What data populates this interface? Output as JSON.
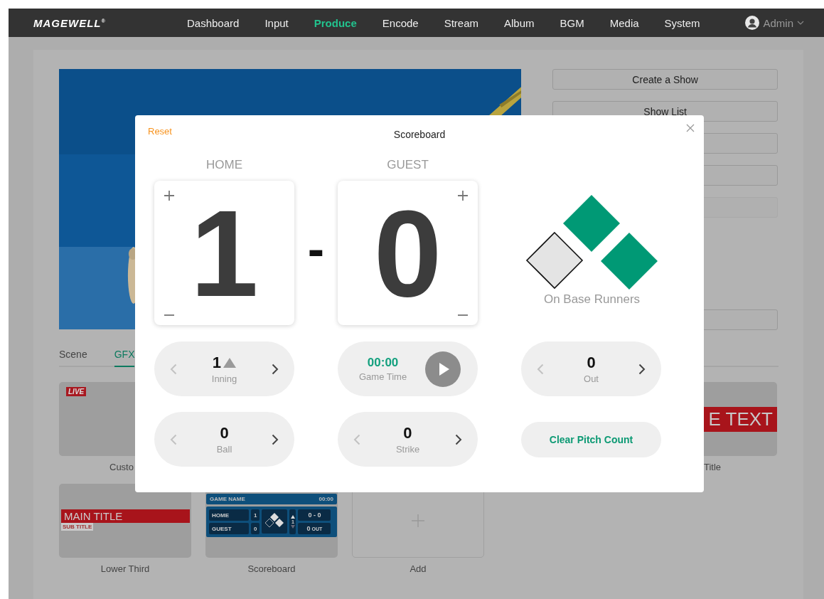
{
  "nav": {
    "logo": "MAGEWELL$^{®}$",
    "items": [
      {
        "label": "Dashboard",
        "selected": false
      },
      {
        "label": "Input",
        "selected": false
      },
      {
        "label": "Produce",
        "selected": true
      },
      {
        "label": "Encode",
        "selected": false
      },
      {
        "label": "Stream",
        "selected": false
      },
      {
        "label": "Album",
        "selected": false
      },
      {
        "label": "BGM",
        "selected": false
      },
      {
        "label": "Media",
        "selected": false
      },
      {
        "label": "System",
        "selected": false
      }
    ],
    "user": "Admin"
  },
  "actions": [
    {
      "label": "Create a Show",
      "disabled": false
    },
    {
      "label": "Show List",
      "disabled": false
    },
    {
      "disabled": false
    },
    {
      "disabled": false
    },
    {
      "disabled": true
    },
    {
      "disabled": false
    }
  ],
  "tabs": [
    {
      "label": "Scene",
      "selected": false
    },
    {
      "label": "GFX",
      "selected": true
    }
  ],
  "gfx_rows": [
    [
      {
        "kind": "live",
        "badge": "LIVE",
        "label": "Custo"
      },
      {
        "kind": "title-bar",
        "bar_text": "E TEXT",
        "label": "Title"
      }
    ],
    [
      {
        "kind": "lower-third",
        "main": "MAIN TITLE",
        "sub": "SUB TITLE",
        "label": "Lower Third"
      },
      {
        "kind": "scoreboard",
        "game_name": "GAME NAME",
        "time": "00:00",
        "home": "HOME",
        "home_score": "1",
        "guest": "GUEST",
        "guest_score": "0",
        "inning": "1",
        "count": "0 - 0",
        "outs": "0",
        "outs_label": "OUT",
        "label": "Scoreboard"
      },
      {
        "kind": "add",
        "label": "Add"
      }
    ]
  ],
  "scoreboard_dialog": {
    "reset": "Reset",
    "title": "Scoreboard",
    "teams": [
      {
        "name": "HOME",
        "score": "1"
      },
      {
        "name": "GUEST",
        "score": "0"
      }
    ],
    "separator": "-",
    "bases": {
      "first": true,
      "second": true,
      "third": false
    },
    "bases_label": "On Base Runners",
    "counters": [
      {
        "kind": "inning",
        "value": "1",
        "label": "Inning",
        "top_half": true,
        "can_decrease": false
      },
      {
        "kind": "timer",
        "value": "00:00",
        "label": "Game Time",
        "running": false
      },
      {
        "kind": "counter",
        "value": "0",
        "label": "Out",
        "can_decrease": false
      },
      {
        "kind": "counter",
        "value": "0",
        "label": "Ball",
        "can_decrease": false
      },
      {
        "kind": "counter",
        "value": "0",
        "label": "Strike",
        "can_decrease": false
      },
      {
        "kind": "action",
        "label": "Clear Pitch Count"
      }
    ]
  }
}
